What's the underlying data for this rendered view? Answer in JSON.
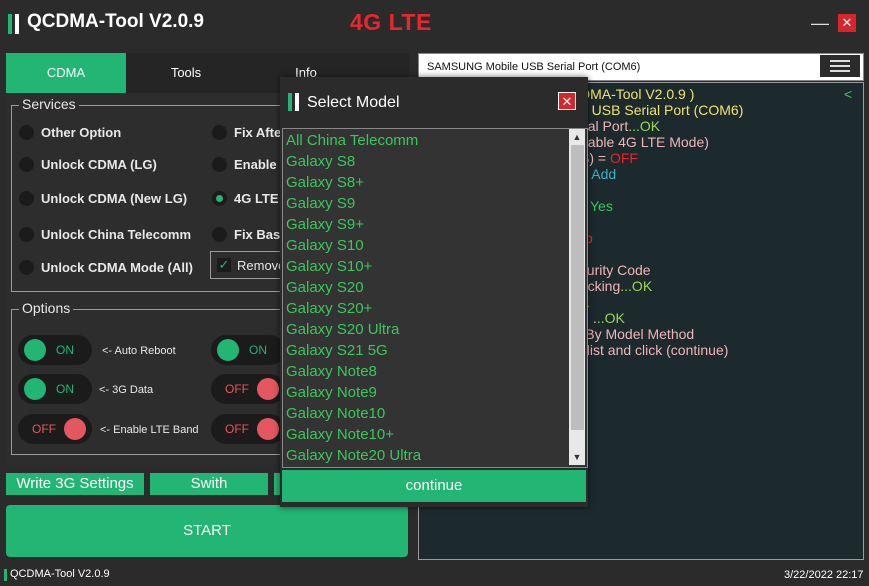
{
  "window": {
    "title": "QCDMA-Tool V2.0.9",
    "mode_title": "4G LTE",
    "minimize_glyph": "—",
    "close_glyph": "✕"
  },
  "tabs": [
    {
      "label": "CDMA",
      "active": true
    },
    {
      "label": "Tools",
      "active": false
    },
    {
      "label": "Info",
      "active": false
    }
  ],
  "services": {
    "title": "Services",
    "left": [
      {
        "label": "Other Option",
        "checked": false
      },
      {
        "label": "Unlock CDMA (LG)",
        "checked": false
      },
      {
        "label": "Unlock CDMA (New LG)",
        "checked": false
      },
      {
        "label": "Unlock China Telecomm",
        "checked": false
      },
      {
        "label": "Unlock CDMA Mode (All)",
        "checked": false
      }
    ],
    "right": [
      {
        "label": "Fix Afte",
        "checked": false
      },
      {
        "label": "Enable",
        "checked": false
      },
      {
        "label": "4G LTE",
        "checked": true
      },
      {
        "label": "Fix Bas",
        "checked": false
      }
    ],
    "checkbox": {
      "label": "Remove",
      "checked": true,
      "glyph": "✓"
    }
  },
  "options": {
    "title": "Options",
    "left": [
      {
        "state": "ON",
        "label": "<- Auto Reboot"
      },
      {
        "state": "ON",
        "label": "<- 3G Data"
      },
      {
        "state": "OFF",
        "label": "<- Enable LTE Band"
      }
    ],
    "right": [
      {
        "state": "ON"
      },
      {
        "state": "OFF"
      },
      {
        "state": "OFF"
      }
    ]
  },
  "buttons": {
    "write": "Write 3G Settings",
    "switch": "Swith",
    "start": "START"
  },
  "port": {
    "label": "SAMSUNG Mobile USB Serial Port  (COM6)"
  },
  "log": [
    {
      "parts": [
        {
          "text": "DMA-Tool V2.0.9 )",
          "color": "#f0e36a"
        }
      ]
    },
    {
      "parts": [
        {
          "text": "e USB Serial Port  (COM6)",
          "color": "#f0e36a"
        }
      ]
    },
    {
      "parts": [
        {
          "text": "rial Port",
          "color": "#f4b3b3"
        },
        {
          "text": "...OK",
          "color": "#9ad84f"
        }
      ]
    },
    {
      "parts": [
        {
          "text": "nable 4G LTE Mode)",
          "color": "#f4b3b3"
        }
      ]
    },
    {
      "parts": [
        {
          "text": "S) = ",
          "color": "#f4b3b3"
        },
        {
          "text": " OFF",
          "color": "#e8262b"
        }
      ]
    },
    {
      "parts": [
        {
          "text": " =  ",
          "color": "#f4b3b3"
        },
        {
          "text": "Add",
          "color": "#3ab0c8"
        }
      ]
    },
    {
      "parts": [
        {
          "text": "Yes",
          "color": "#3ac75a"
        }
      ]
    },
    {
      "parts": [
        {
          "text": "o",
          "color": "#e8262b"
        }
      ]
    },
    {
      "parts": [
        {
          "text": "ecurity Code",
          "color": "#f4b3b3"
        }
      ]
    },
    {
      "parts": [
        {
          "text": "hecking",
          "color": "#f4b3b3"
        },
        {
          "text": "...OK",
          "color": "#9ad84f"
        }
      ]
    },
    {
      "parts": [
        {
          "text": "K",
          "color": "#9ad84f"
        }
      ]
    },
    {
      "parts": [
        {
          "text": ".",
          "color": "#f4b3b3"
        },
        {
          "text": "..OK",
          "color": "#9ad84f"
        }
      ]
    },
    {
      "parts": [
        {
          "text": "E By Model Method",
          "color": "#f4b3b3"
        }
      ]
    },
    {
      "parts": [
        {
          "text": "el list and click (continue)",
          "color": "#f4b3b3"
        }
      ]
    }
  ],
  "log_marker": "<",
  "status": {
    "app": "QCDMA-Tool V2.0.9",
    "datetime": "3/22/2022 22:17"
  },
  "modal": {
    "title": "Select Model",
    "close_glyph": "✕",
    "continue": "continue",
    "models": [
      "All China Telecomm",
      "Galaxy S8",
      "Galaxy S8+",
      "Galaxy S9",
      "Galaxy S9+",
      "Galaxy S10",
      "Galaxy S10+",
      "Galaxy S20",
      "Galaxy S20+",
      "Galaxy S20 Ultra",
      "Galaxy S21 5G",
      "Galaxy Note8",
      "Galaxy Note9",
      "Galaxy Note10",
      "Galaxy Note10+",
      "Galaxy Note20 Ultra"
    ],
    "scroll_up_glyph": "▲",
    "scroll_down_glyph": "▼"
  },
  "colors": {
    "accent": "#22b573",
    "danger": "#e8262b",
    "background": "#2b2b2b"
  }
}
